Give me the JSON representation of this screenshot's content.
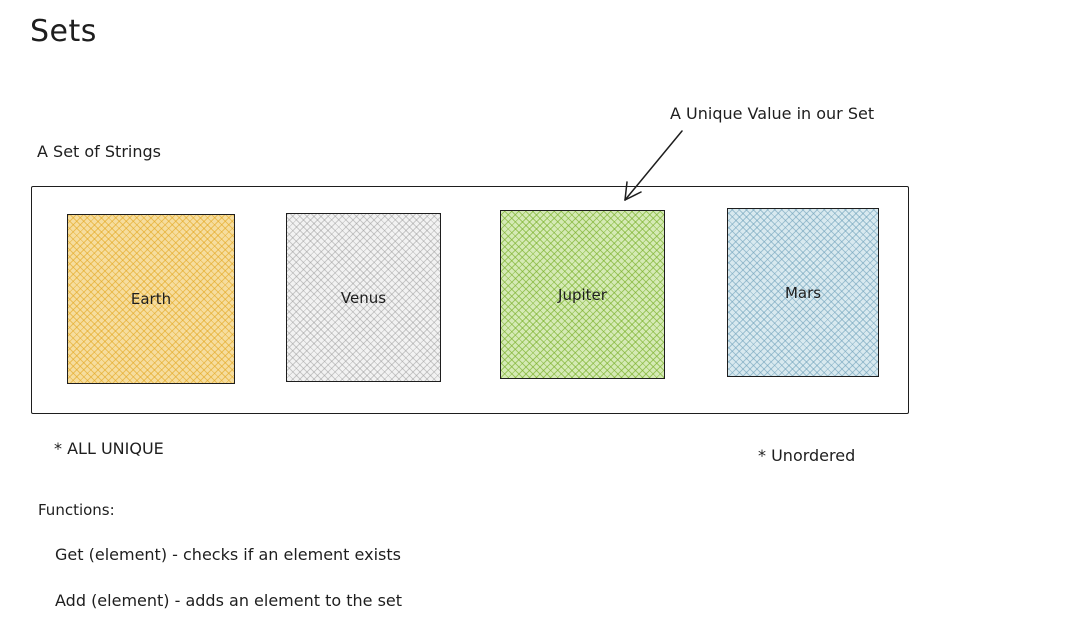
{
  "title": "Sets",
  "set_label": "A Set of Strings",
  "annotation": "A Unique Value in our Set",
  "elements": [
    {
      "label": "Earth",
      "color": "#e2a51c"
    },
    {
      "label": "Venus",
      "color": "#b0b0b0"
    },
    {
      "label": "Jupiter",
      "color": "#7aaf28"
    },
    {
      "label": "Mars",
      "color": "#6ea0b9"
    }
  ],
  "notes": {
    "unique": "* ALL UNIQUE",
    "unordered": "* Unordered"
  },
  "functions": {
    "heading": "Functions:",
    "items": [
      "Get (element) - checks if an element exists",
      "Add (element) - adds an element to the set"
    ]
  }
}
